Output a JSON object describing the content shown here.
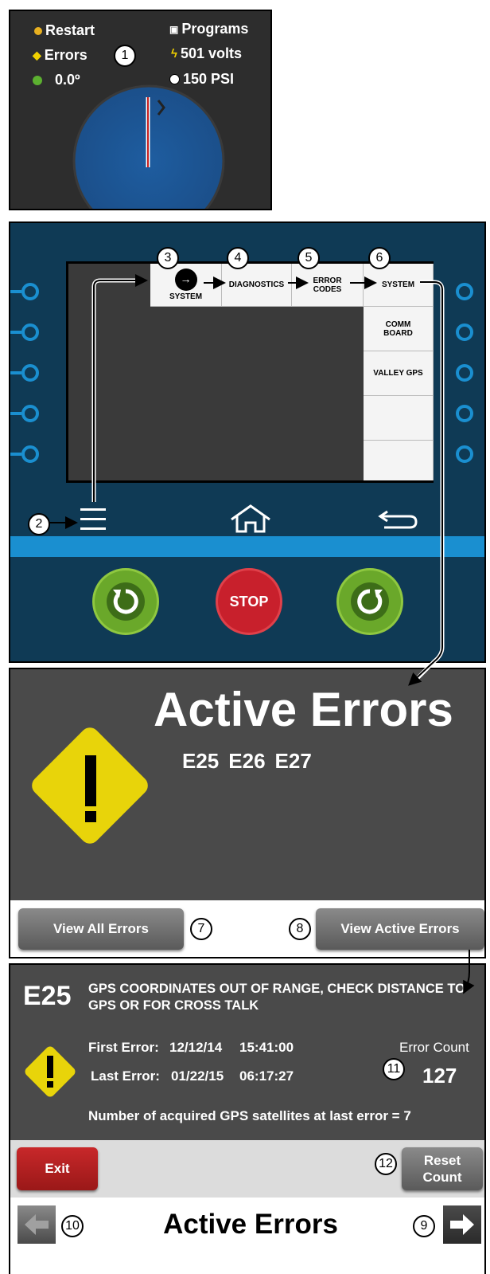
{
  "status_panel": {
    "restart_label": "Restart",
    "programs_label": "Programs",
    "errors_label": "Errors",
    "voltage_value": "501 volts",
    "angle_value": "0.0º",
    "pressure_value": "150 PSI",
    "callout": "1"
  },
  "control_panel": {
    "menu": {
      "system_start_label": "SYSTEM",
      "diagnostics_label": "DIAGNOSTICS",
      "error_codes_label": "ERROR CODES",
      "system_label": "SYSTEM",
      "comm_board_label": "COMM BOARD",
      "valley_gps_label": "VALLEY GPS"
    },
    "stop_label": "STOP",
    "callouts": [
      "2",
      "3",
      "4",
      "5",
      "6"
    ]
  },
  "active_errors_panel": {
    "title": "Active Errors",
    "error_codes": [
      "E25",
      "E26",
      "E27"
    ],
    "view_all_label": "View All Errors",
    "view_active_label": "View Active Errors",
    "callouts": [
      "7",
      "8"
    ]
  },
  "error_detail_panel": {
    "code": "E25",
    "description": "GPS COORDINATES OUT OF RANGE, CHECK DISTANCE TO GPS OR FOR CROSS TALK",
    "first_error_label": "First Error:",
    "first_error_date": "12/12/14",
    "first_error_time": "15:41:00",
    "last_error_label": "Last Error:",
    "last_error_date": "01/22/15",
    "last_error_time": "06:17:27",
    "error_count_label": "Error Count",
    "error_count": "127",
    "satellites_text": "Number of acquired GPS satellites at last error = 7",
    "exit_label": "Exit",
    "reset_label": "Reset Count",
    "footer_title": "Active Errors",
    "callouts": [
      "9",
      "10",
      "11",
      "12"
    ]
  },
  "colors": {
    "accent_blue": "#1a8fd0",
    "stop_red": "#c8202c",
    "rotate_green": "#6aa82a",
    "warning_yellow": "#e8d40a",
    "exit_red": "#b81f1f"
  }
}
